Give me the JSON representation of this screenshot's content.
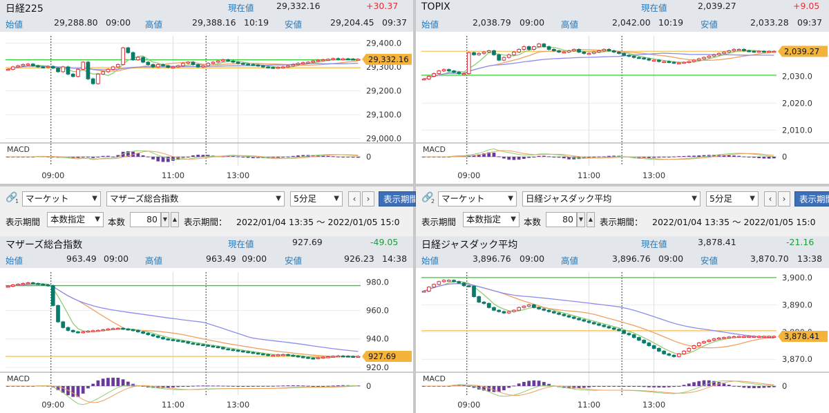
{
  "colors": {
    "up": "#e0303a",
    "down": "#1f9a3c",
    "label": "#2878b8",
    "header_bg": "#e3e7ec",
    "bullet_candle": "#0a7a6a",
    "price_tag": "#f4b43c",
    "ma_short": "#8fce70",
    "ma_mid": "#f0a060",
    "ma_long": "#8c8cf0",
    "hline_green": "#33cc33",
    "hline_orange": "#f6c45a",
    "button_blue": "#3d6fb8"
  },
  "panels": [
    {
      "name": "日経225",
      "labels": {
        "current": "現在値",
        "open": "始値",
        "high": "高値",
        "low": "安値"
      },
      "current": "29,332.16",
      "change": "+30.37",
      "change_dir": "up",
      "open": "29,288.80",
      "open_time": "09:00",
      "high": "29,388.16",
      "high_time": "10:19",
      "low": "29,204.45",
      "low_time": "09:37",
      "price_tag": "29,332.16",
      "yticks": [
        "29,400.0",
        "29,300.0",
        "29,200.0",
        "29,100.0",
        "29,000.0"
      ],
      "xticks": [
        "09:00",
        "11:00",
        "13:00"
      ],
      "macd_label": "MACD",
      "macd_zero": "0"
    },
    {
      "name": "TOPIX",
      "labels": {
        "current": "現在値",
        "open": "始値",
        "high": "高値",
        "low": "安値"
      },
      "current": "2,039.27",
      "change": "+9.05",
      "change_dir": "up",
      "open": "2,038.79",
      "open_time": "09:00",
      "high": "2,042.00",
      "high_time": "10:19",
      "low": "2,033.28",
      "low_time": "09:37",
      "price_tag": "2,039.27",
      "yticks": [
        "2,030.0",
        "2,020.0",
        "2,010.0"
      ],
      "xticks": [
        "09:00",
        "11:00",
        "13:00"
      ],
      "macd_label": "MACD",
      "macd_zero": "0"
    },
    {
      "name": "マザーズ総合指数",
      "labels": {
        "current": "現在値",
        "open": "始値",
        "high": "高値",
        "low": "安値"
      },
      "current": "927.69",
      "change": "-49.05",
      "change_dir": "down",
      "open": "963.49",
      "open_time": "09:00",
      "high": "963.49",
      "high_time": "09:00",
      "low": "926.23",
      "low_time": "14:38",
      "price_tag": "927.69",
      "yticks": [
        "980.0",
        "960.0",
        "940.0",
        "920.0"
      ],
      "xticks": [
        "09:00",
        "11:00",
        "13:00"
      ],
      "macd_label": "MACD",
      "macd_zero": "0"
    },
    {
      "name": "日経ジャスダック平均",
      "labels": {
        "current": "現在値",
        "open": "始値",
        "high": "高値",
        "low": "安値"
      },
      "current": "3,878.41",
      "change": "-21.16",
      "change_dir": "down",
      "open": "3,896.76",
      "open_time": "09:00",
      "high": "3,896.76",
      "high_time": "09:00",
      "low": "3,870.70",
      "low_time": "13:38",
      "price_tag": "3,878.41",
      "yticks": [
        "3,900.0",
        "3,890.0",
        "3,880.0",
        "3,870.0"
      ],
      "xticks": [
        "09:00",
        "11:00",
        "13:00"
      ],
      "macd_label": "MACD",
      "macd_zero": "0"
    }
  ],
  "controls": [
    {
      "link_num": "1",
      "market": "マーケット",
      "index": "マザーズ総合指数",
      "interval": "5分足",
      "show_period_btn": "表示期間",
      "period_label": "表示期間",
      "period_mode": "本数指定",
      "count_label": "本数",
      "count": "80",
      "range_label": "表示期間：",
      "range": "2022/01/04 13:35 ～ 2022/01/05 15:0"
    },
    {
      "link_num": "2",
      "market": "マーケット",
      "index": "日経ジャスダック平均",
      "interval": "5分足",
      "show_period_btn": "表示期間",
      "period_label": "表示期間",
      "period_mode": "本数指定",
      "count_label": "本数",
      "count": "80",
      "range_label": "表示期間：",
      "range": "2022/01/04 13:35 ～ 2022/01/05 15:0"
    }
  ],
  "chart_data": [
    {
      "type": "candlestick",
      "title": "日経225",
      "ylim": [
        28990,
        29430
      ],
      "x": [
        "13:35",
        "13:45",
        "13:55",
        "14:05",
        "14:15",
        "14:25",
        "14:35",
        "14:45",
        "14:55",
        "09:00",
        "09:05",
        "09:10",
        "09:15",
        "09:20",
        "09:25",
        "09:30",
        "09:35",
        "09:40",
        "09:45",
        "09:50",
        "09:55",
        "10:00",
        "10:05",
        "10:10",
        "10:15",
        "10:20",
        "10:25",
        "10:30",
        "10:35",
        "10:40",
        "10:45",
        "10:50",
        "10:55",
        "11:00",
        "11:05",
        "11:10",
        "11:15",
        "11:20",
        "11:25",
        "11:30",
        "12:30",
        "12:35",
        "12:40",
        "12:45",
        "12:50",
        "12:55",
        "13:00",
        "13:05",
        "13:10",
        "13:15",
        "13:20",
        "13:25",
        "13:30",
        "13:35",
        "13:40",
        "13:45",
        "13:50",
        "13:55",
        "14:00",
        "14:05",
        "14:10",
        "14:15",
        "14:20",
        "14:25",
        "14:30",
        "14:35",
        "14:40",
        "14:45",
        "14:50",
        "14:55",
        "15:00"
      ],
      "close": [
        29290,
        29300,
        29305,
        29310,
        29312,
        29305,
        29300,
        29298,
        29302,
        29295,
        29280,
        29300,
        29270,
        29260,
        29290,
        29320,
        29250,
        29230,
        29270,
        29280,
        29290,
        29300,
        29310,
        29380,
        29360,
        29330,
        29340,
        29320,
        29310,
        29300,
        29310,
        29305,
        29298,
        29300,
        29305,
        29315,
        29320,
        29310,
        29300,
        29305,
        29315,
        29320,
        29325,
        29330,
        29325,
        29320,
        29315,
        29312,
        29310,
        29308,
        29305,
        29300,
        29298,
        29296,
        29298,
        29300,
        29305,
        29310,
        29315,
        29318,
        29320,
        29325,
        29328,
        29330,
        29332,
        29335,
        29332,
        29334,
        29333,
        29332,
        29332
      ],
      "ma_short_end": 29315,
      "ma_mid_end": 29305,
      "ma_long_start": 29030,
      "ma_long_end": 29300,
      "hlines": [
        29330,
        29296
      ],
      "macd_range": [
        -1,
        1
      ]
    },
    {
      "type": "candlestick",
      "title": "TOPIX",
      "ylim": [
        2006,
        2045
      ],
      "x": [
        "13:35",
        "13:45",
        "13:55",
        "14:05",
        "14:15",
        "14:25",
        "14:35",
        "14:45",
        "14:55",
        "09:00",
        "09:05",
        "09:10",
        "09:15",
        "09:20",
        "09:25",
        "09:30",
        "09:35",
        "09:40",
        "09:45",
        "09:50",
        "09:55",
        "10:00",
        "10:05",
        "10:10",
        "10:15",
        "10:20",
        "10:25",
        "10:30",
        "10:35",
        "10:40",
        "10:45",
        "10:50",
        "10:55",
        "11:00",
        "11:05",
        "11:10",
        "11:15",
        "11:20",
        "11:25",
        "11:30",
        "12:30",
        "12:35",
        "12:40",
        "12:45",
        "12:50",
        "12:55",
        "13:00",
        "13:05",
        "13:10",
        "13:15",
        "13:20",
        "13:25",
        "13:30",
        "13:35",
        "13:40",
        "13:45",
        "13:50",
        "13:55",
        "14:00",
        "14:05",
        "14:10",
        "14:15",
        "14:20",
        "14:25",
        "14:30",
        "14:35",
        "14:40",
        "14:45",
        "14:50",
        "14:55",
        "15:00"
      ],
      "close": [
        2029,
        2030,
        2031,
        2032,
        2032.5,
        2032,
        2031.5,
        2031,
        2031,
        2038.8,
        2038,
        2038.5,
        2039,
        2039.5,
        2038,
        2036,
        2037,
        2038,
        2039,
        2040,
        2041,
        2040,
        2041,
        2042,
        2041,
        2040,
        2039.5,
        2039,
        2039,
        2039.5,
        2040,
        2039,
        2038.5,
        2038.5,
        2039,
        2039.5,
        2040,
        2039.5,
        2039,
        2038.5,
        2037.8,
        2037.5,
        2037,
        2036.8,
        2036.5,
        2036,
        2036,
        2035.5,
        2035.5,
        2035.2,
        2035,
        2035,
        2035.2,
        2035.5,
        2036,
        2036.5,
        2037,
        2037.5,
        2038,
        2038.5,
        2039,
        2039.5,
        2040,
        2040,
        2039.5,
        2039.3,
        2039.2,
        2039.3,
        2039.27,
        2039.27,
        2039.27
      ],
      "hlines": [
        2030.4,
        2039.3
      ],
      "macd_range": [
        -1,
        1
      ]
    },
    {
      "type": "candlestick",
      "title": "マザーズ総合指数",
      "ylim": [
        918,
        987
      ],
      "x": [
        "13:35",
        "13:45",
        "13:55",
        "14:05",
        "14:15",
        "14:25",
        "14:35",
        "14:45",
        "14:55",
        "09:00",
        "09:05",
        "09:10",
        "09:15",
        "09:20",
        "09:25",
        "09:30",
        "09:35",
        "09:40",
        "09:45",
        "09:50",
        "09:55",
        "10:00",
        "10:05",
        "10:10",
        "10:15",
        "10:20",
        "10:25",
        "10:30",
        "10:35",
        "10:40",
        "10:45",
        "10:50",
        "10:55",
        "11:00",
        "11:05",
        "11:10",
        "11:15",
        "11:20",
        "11:25",
        "11:30",
        "12:30",
        "12:35",
        "12:40",
        "12:45",
        "12:50",
        "12:55",
        "13:00",
        "13:05",
        "13:10",
        "13:15",
        "13:20",
        "13:25",
        "13:30",
        "13:35",
        "13:40",
        "13:45",
        "13:50",
        "13:55",
        "14:00",
        "14:05",
        "14:10",
        "14:15",
        "14:20",
        "14:25",
        "14:30",
        "14:35",
        "14:40",
        "14:45",
        "14:50",
        "14:55",
        "15:00"
      ],
      "close": [
        977,
        978,
        978.5,
        979,
        979.5,
        979,
        978.5,
        978,
        977.5,
        963.5,
        952,
        948,
        946,
        945,
        944.5,
        945,
        945.5,
        945.8,
        946,
        946.5,
        947,
        947.3,
        947.5,
        947,
        946.5,
        946,
        945,
        944,
        943,
        942,
        941,
        940,
        939.5,
        939,
        938.5,
        938,
        937,
        936.5,
        936,
        935.5,
        935,
        934.5,
        934,
        933,
        932.5,
        932,
        931.5,
        931,
        930.5,
        930,
        929.5,
        929,
        928.5,
        928.5,
        928.8,
        929,
        928.5,
        928,
        927.5,
        927,
        926.5,
        926.3,
        926.8,
        927.2,
        927.5,
        927.8,
        928,
        927.9,
        927.7,
        927.69,
        927.69
      ],
      "hlines": [
        977.5,
        927.7
      ],
      "macd_range": [
        -1,
        1
      ]
    },
    {
      "type": "candlestick",
      "title": "日経ジャスダック平均",
      "ylim": [
        3866,
        3902
      ],
      "x": [
        "13:35",
        "13:45",
        "13:55",
        "14:05",
        "14:15",
        "14:25",
        "14:35",
        "14:45",
        "14:55",
        "09:00",
        "09:05",
        "09:10",
        "09:15",
        "09:20",
        "09:25",
        "09:30",
        "09:35",
        "09:40",
        "09:45",
        "09:50",
        "09:55",
        "10:00",
        "10:05",
        "10:10",
        "10:15",
        "10:20",
        "10:25",
        "10:30",
        "10:35",
        "10:40",
        "10:45",
        "10:50",
        "10:55",
        "11:00",
        "11:05",
        "11:10",
        "11:15",
        "11:20",
        "11:25",
        "11:30",
        "12:30",
        "12:35",
        "12:40",
        "12:45",
        "12:50",
        "12:55",
        "13:00",
        "13:05",
        "13:10",
        "13:15",
        "13:20",
        "13:25",
        "13:30",
        "13:35",
        "13:40",
        "13:45",
        "13:50",
        "13:55",
        "14:00",
        "14:05",
        "14:10",
        "14:15",
        "14:20",
        "14:25",
        "14:30",
        "14:35",
        "14:40",
        "14:45",
        "14:50",
        "14:55",
        "15:00"
      ],
      "close": [
        3895,
        3896.5,
        3897.5,
        3898.5,
        3899,
        3899,
        3898.5,
        3898,
        3897,
        3896.8,
        3893,
        3891,
        3890.5,
        3889,
        3888,
        3887.5,
        3887,
        3887.5,
        3888,
        3889,
        3889.5,
        3890,
        3889,
        3888.5,
        3888,
        3887.5,
        3887,
        3886.5,
        3886,
        3885.5,
        3885,
        3884.5,
        3884,
        3883.5,
        3883,
        3882.5,
        3882,
        3881.5,
        3881,
        3880.5,
        3879.5,
        3879,
        3878,
        3877,
        3876,
        3875,
        3874,
        3873,
        3872,
        3871.5,
        3871,
        3872,
        3873,
        3874,
        3875,
        3876,
        3876.5,
        3877,
        3877.5,
        3877.8,
        3878,
        3878.2,
        3878.3,
        3878.4,
        3878.41,
        3878.41,
        3878.41,
        3878.41,
        3878.41,
        3878.41,
        3878.41
      ],
      "hlines": [
        3900,
        3880.5
      ],
      "macd_range": [
        -1,
        1
      ]
    }
  ]
}
